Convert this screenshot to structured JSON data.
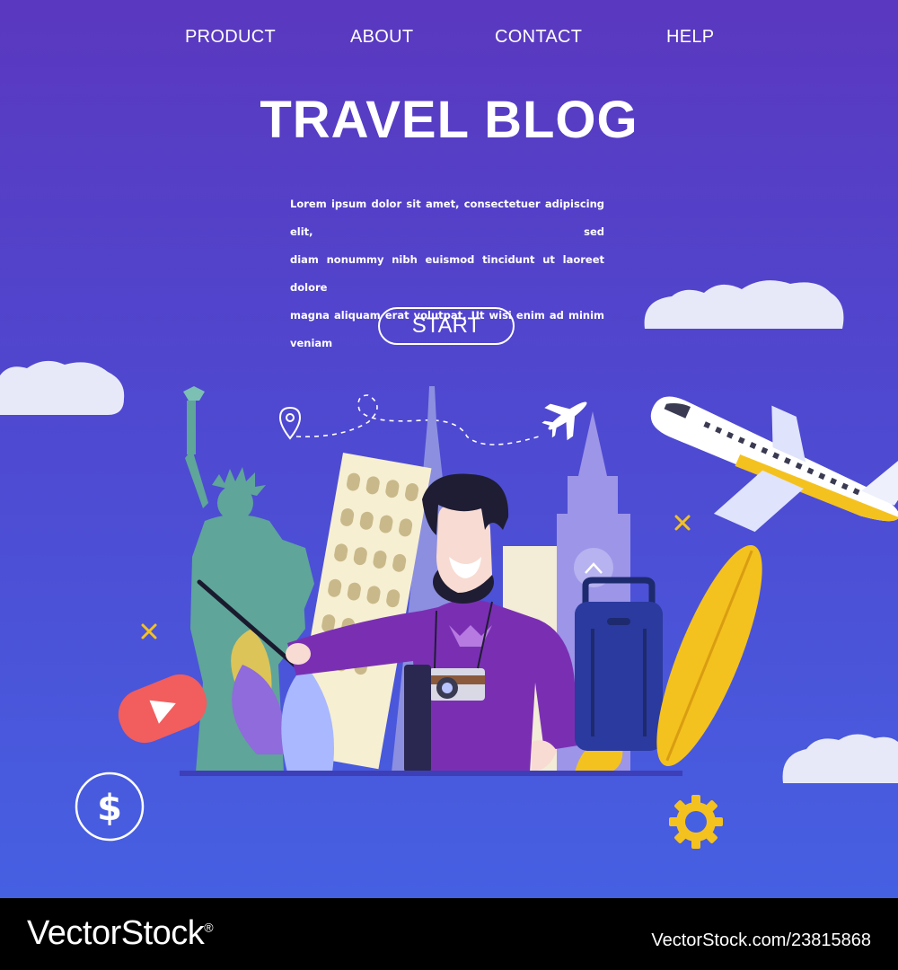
{
  "nav": {
    "items": [
      {
        "label": "PRODUCT"
      },
      {
        "label": "ABOUT"
      },
      {
        "label": "CONTACT"
      },
      {
        "label": "HELP"
      }
    ]
  },
  "hero": {
    "title": "TRAVEL BLOG",
    "description_lines": [
      "Lorem ipsum dolor sit amet, consectetuer adipiscing elit, sed",
      "diam nonummy nibh euismod tincidunt ut laoreet dolore",
      "magna aliquam erat volutpat. Ut wisi enim ad minim veniam"
    ],
    "start_label": "START"
  },
  "icons": {
    "location": "location-pin-icon",
    "small_plane": "airplane-icon",
    "video": "play-video-icon",
    "dollar": "dollar-icon",
    "gear": "gear-icon"
  },
  "watermark": {
    "brand": "VectorStock",
    "registered": "®",
    "image_id": "VectorStock.com/23815868"
  },
  "colors": {
    "background_top": "#5a38bf",
    "background_bottom": "#4660e2",
    "accent_yellow": "#f4c21f",
    "video_red": "#f25d5d",
    "shirt_purple": "#7a2fb3",
    "statue_green": "#5fa59a"
  }
}
